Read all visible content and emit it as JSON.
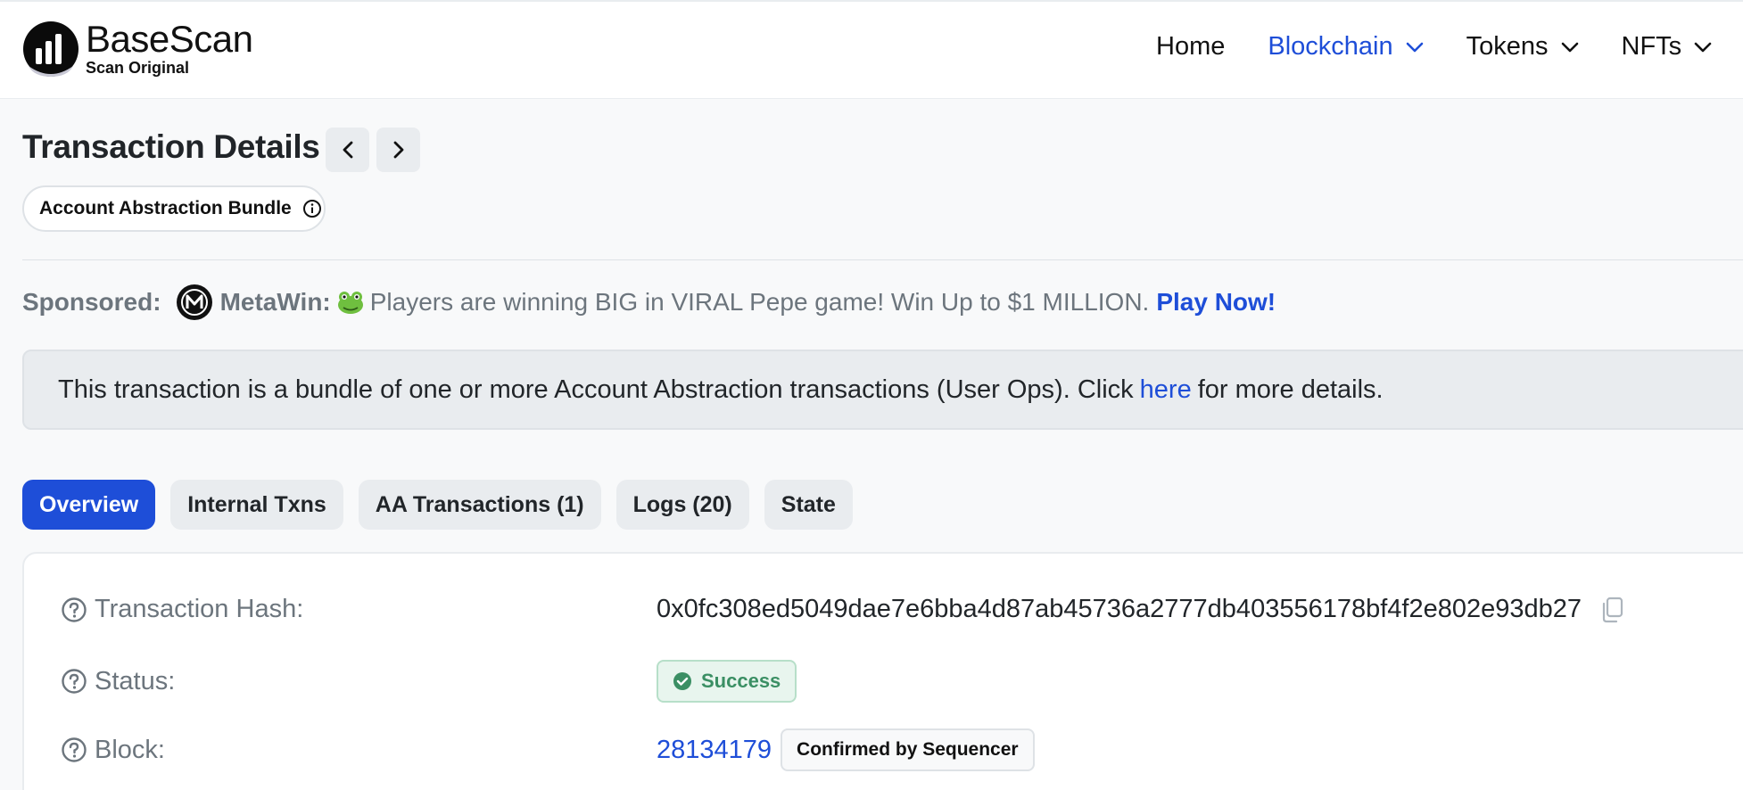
{
  "header": {
    "logo_title": "BaseScan",
    "logo_subtitle": "Scan Original",
    "nav": [
      {
        "label": "Home"
      },
      {
        "label": "Blockchain"
      },
      {
        "label": "Tokens"
      },
      {
        "label": "NFTs"
      }
    ]
  },
  "page": {
    "title": "Transaction Details",
    "badge": "Account Abstraction Bundle"
  },
  "sponsor": {
    "label": "Sponsored:",
    "brand": "MetaWin:",
    "text": "Players are winning BIG in VIRAL Pepe game! Win Up to $1 MILLION.",
    "cta": "Play Now!"
  },
  "alert": {
    "before": "This transaction is a bundle of one or more Account Abstraction transactions (User Ops). Click",
    "link": "here",
    "after": "for more details."
  },
  "tabs": [
    {
      "label": "Overview",
      "active": true
    },
    {
      "label": "Internal Txns"
    },
    {
      "label": "AA Transactions (1)"
    },
    {
      "label": "Logs (20)"
    },
    {
      "label": "State"
    }
  ],
  "details": {
    "hash_label": "Transaction Hash:",
    "hash_value": "0x0fc308ed5049dae7e6bba4d87ab45736a2777db403556178bf4f2e802e93db27",
    "status_label": "Status:",
    "status_value": "Success",
    "block_label": "Block:",
    "block_value": "28134179",
    "block_badge": "Confirmed by Sequencer"
  },
  "colors": {
    "accent": "#1e4ed8",
    "success": "#3b8f64"
  },
  "icons": [
    "basescan-logo-icon",
    "chevron-down-icon",
    "chevron-left-icon",
    "chevron-right-icon",
    "info-icon",
    "metawin-logo-icon",
    "frog-emoji-icon",
    "question-icon",
    "copy-icon",
    "check-circle-icon"
  ]
}
